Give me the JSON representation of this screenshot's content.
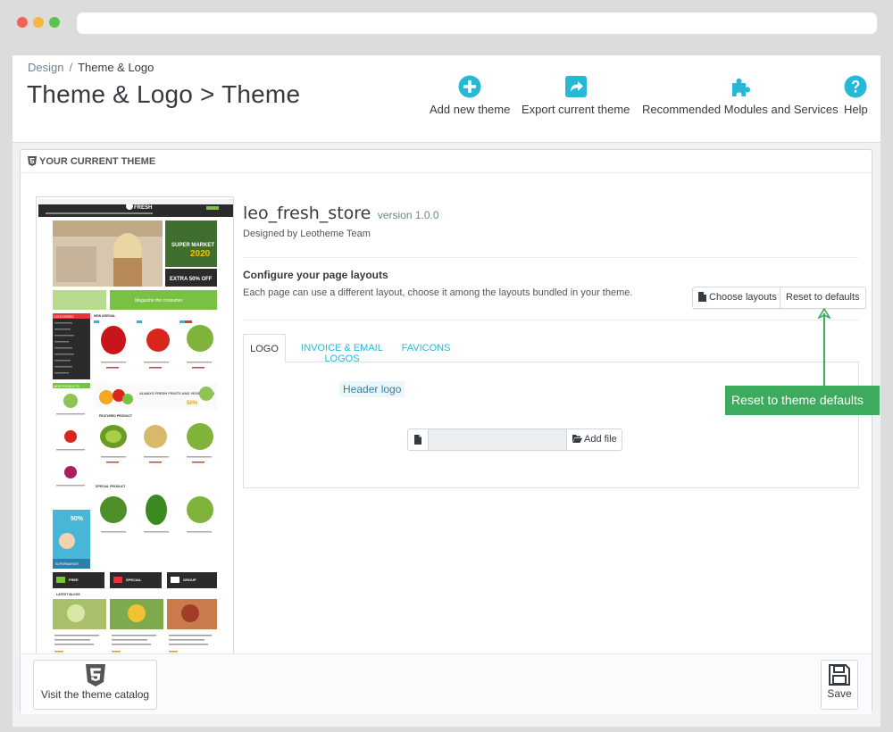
{
  "breadcrumb": {
    "parent": "Design",
    "separator": "/",
    "current": "Theme & Logo"
  },
  "page_title": "Theme & Logo > Theme",
  "toolbar": {
    "add_new_theme": "Add new theme",
    "export_current_theme": "Export current theme",
    "recommended_modules": "Recommended Modules and Services",
    "help": "Help"
  },
  "panel": {
    "heading": "YOUR CURRENT THEME"
  },
  "theme": {
    "name": "leo_fresh_store",
    "version": "version 1.0.0",
    "designed_by": "Designed by Leotheme Team"
  },
  "layouts": {
    "title": "Configure your page layouts",
    "description": "Each page can use a different layout, choose it among the layouts bundled in your theme.",
    "choose_layouts": "Choose layouts",
    "reset_defaults": "Reset to defaults"
  },
  "tabs": [
    {
      "label": "LOGO",
      "active": true
    },
    {
      "label": "INVOICE & EMAIL LOGOS",
      "active": false
    },
    {
      "label": "FAVICONS",
      "active": false
    }
  ],
  "logo_tab": {
    "header_logo_label": "Header logo",
    "add_file": "Add file",
    "file_value": ""
  },
  "annotation": {
    "callout": "Reset to theme defaults"
  },
  "footer": {
    "visit_catalog": "Visit the theme catalog",
    "save": "Save"
  },
  "preview_text": {
    "logo": "FRESH",
    "banner1": "SUPER MARKET",
    "banner_year": "2020",
    "banner_offer": "EXTRA 50% OFF",
    "banner_mag": "Magazine the consumer",
    "new_arrival": "NEW ARRIVAL",
    "categories": "CATEGORIES",
    "new_products": "NEW PRODUCTS",
    "always_fresh": "ALWAYS FRESH FRUITS AND VEGETABLES",
    "always_pct": "50%",
    "featured": "FEATURED PRODUCT",
    "special": "SPECIAL PRODUCT",
    "side_pct": "50%",
    "side_label": "SUPERMARKET",
    "strip1": "FREE",
    "strip2": "SPECIAL",
    "strip3": "GROUP",
    "blogs": "LATEST BLOGS"
  },
  "colors": {
    "accent": "#25b9d7",
    "callout": "#3dab5d",
    "preview_dark": "#2b2b2b",
    "preview_red": "#e1363e",
    "preview_green": "#79c142"
  }
}
